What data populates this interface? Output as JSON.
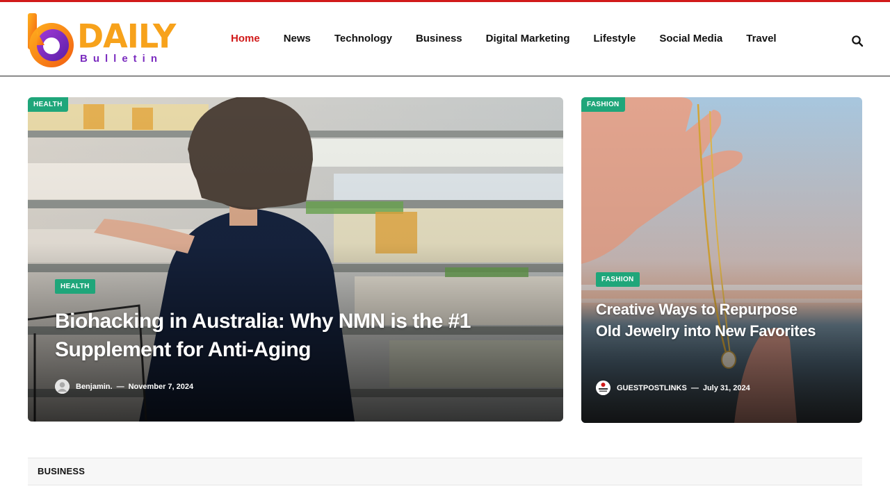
{
  "site": {
    "logo_top": "DAILY",
    "logo_bottom": "Bulletin",
    "colors": {
      "accent": "#d11a1a",
      "tag": "#1fa67a",
      "logo_orange": "#f7a21b",
      "logo_purple": "#7b2cbf"
    }
  },
  "nav": {
    "items": [
      {
        "label": "Home",
        "active": true
      },
      {
        "label": "News"
      },
      {
        "label": "Technology"
      },
      {
        "label": "Business"
      },
      {
        "label": "Digital Marketing"
      },
      {
        "label": "Lifestyle"
      },
      {
        "label": "Social Media"
      },
      {
        "label": "Travel"
      }
    ],
    "search_icon": "search-icon"
  },
  "featured": {
    "main": {
      "corner_tag": "HEALTH",
      "tag": "HEALTH",
      "title": "Biohacking in Australia: Why NMN is the #1 Supplement for Anti-Aging",
      "author": "Benjamin.",
      "separator": "—",
      "date": "November 7, 2024"
    },
    "side": {
      "corner_tag": "FASHION",
      "tag": "FASHION",
      "title": "Creative Ways to Repurpose Old Jewelry into New Favorites",
      "author": "GUESTPOSTLINKS",
      "separator": "—",
      "date": "July 31, 2024"
    }
  },
  "section": {
    "title": "BUSINESS"
  }
}
